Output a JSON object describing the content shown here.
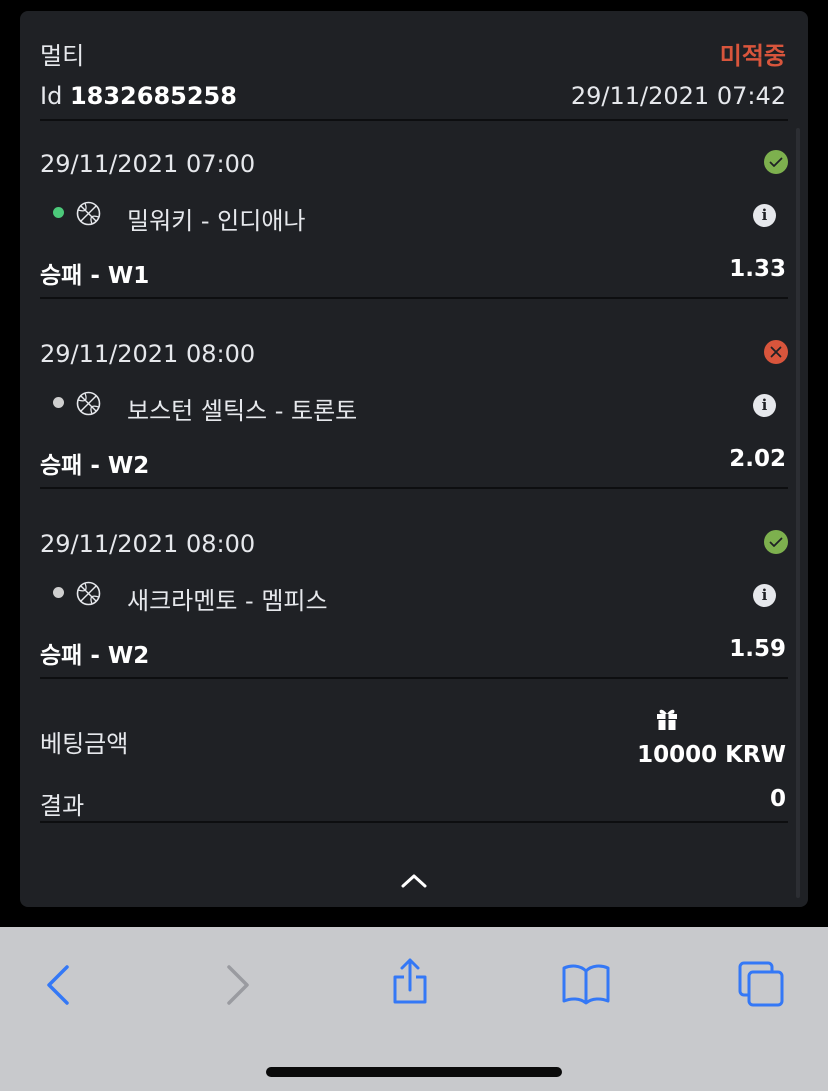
{
  "bet": {
    "type": "멀티",
    "status": "미적중",
    "id_label": "Id",
    "id_value": "1832685258",
    "placed_at": "29/11/2021 07:42"
  },
  "events": [
    {
      "date": "29/11/2021 07:00",
      "result": "won",
      "dot_color": "#4cc97a",
      "sport_icon": "basketball-icon",
      "teams": "밀워키 - 인디애나",
      "market": "승패 - W1",
      "odds": "1.33"
    },
    {
      "date": "29/11/2021 08:00",
      "result": "lost",
      "dot_color": "#cfcfcf",
      "sport_icon": "basketball-icon",
      "teams": "보스턴 셀틱스 - 토론토",
      "market": "승패 - W2",
      "odds": "2.02"
    },
    {
      "date": "29/11/2021 08:00",
      "result": "won",
      "dot_color": "#cfcfcf",
      "sport_icon": "basketball-icon",
      "teams": "새크라멘토 - 멤피스",
      "market": "승패 - W2",
      "odds": "1.59"
    }
  ],
  "summary": {
    "stake_label": "베팅금액",
    "stake_value": "10000 KRW",
    "result_label": "결과",
    "result_value": "0"
  },
  "colors": {
    "lost": "#d8553c",
    "won": "#7db04e",
    "toolbar_accent": "#3478f6"
  },
  "toolbar": {
    "icons": [
      "back-icon",
      "forward-icon",
      "share-icon",
      "bookmarks-icon",
      "tabs-icon"
    ]
  }
}
